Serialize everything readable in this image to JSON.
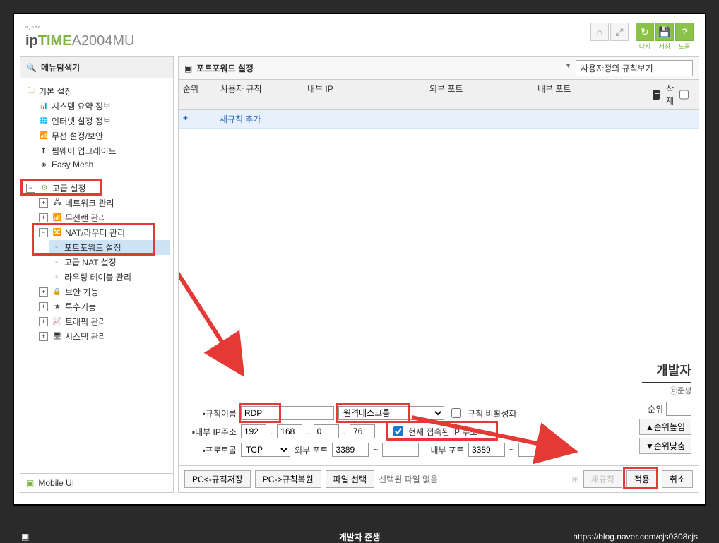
{
  "logo": {
    "prefix": "ip",
    "brand": "TIME",
    "model": "A2004MU",
    "dots": "▫.▫▫▫"
  },
  "header_icons": {
    "refresh": "다시",
    "save": "저장",
    "help": "도움"
  },
  "sidebar": {
    "title": "메뉴탐색기",
    "basic": {
      "label": "기본 설정",
      "items": [
        "시스템 요약 정보",
        "인터넷 설정 정보",
        "무선 설정/보안",
        "펌웨어 업그레이드",
        "Easy Mesh"
      ]
    },
    "advanced": {
      "label": "고급 설정",
      "network": "네트워크 관리",
      "wireless": "무선랜 관리",
      "nat": {
        "label": "NAT/라우터 관리",
        "items": [
          "포트포워드 설정",
          "고급 NAT 설정",
          "라우팅 테이블 관리"
        ]
      },
      "security": "보안 기능",
      "special": "특수기능",
      "traffic": "트래픽 관리",
      "system": "시스템 관리"
    },
    "footer": "Mobile UI"
  },
  "content": {
    "title": "포트포워드 설정",
    "view_dropdown": "사용자정의 규칙보기",
    "columns": {
      "idx": "순위",
      "rule": "사용자 규칙",
      "ip": "내부 IP",
      "extport": "외부 포트",
      "intport": "내부 포트",
      "del": "삭제"
    },
    "add_row": "새규칙 추가",
    "form": {
      "rule_label": "규칙이름",
      "rule_value": "RDP",
      "preset_value": "원격데스크톱",
      "disable_label": "규칙 비활성화",
      "ip_label": "내부 IP주소",
      "ip": [
        "192",
        "168",
        "0",
        "76"
      ],
      "current_ip_label": "현재 접속된 IP 주소",
      "proto_label": "프로토콜",
      "proto_value": "TCP",
      "extport_label": "외부 포트",
      "extport_from": "3389",
      "extport_to": "",
      "intport_label": "내부 포트",
      "intport_from": "3389",
      "intport_to": ""
    },
    "side": {
      "developer": "개발자",
      "sub": "ⓒ준생",
      "priority_label": "순위",
      "priority_value": "",
      "up": "▲순위높임",
      "down": "▼순위낮춤"
    },
    "buttons": {
      "save_rule": "PC<-규칙저장",
      "restore_rule": "PC->규칙복원",
      "file_select": "파일 선택",
      "no_file": "선택된 파일 없음",
      "new_rule": "새규칙",
      "apply": "적용",
      "cancel": "취소"
    }
  },
  "footer": {
    "center": "개발자 준생",
    "right": "https://blog.naver.com/cjs0308cjs"
  }
}
